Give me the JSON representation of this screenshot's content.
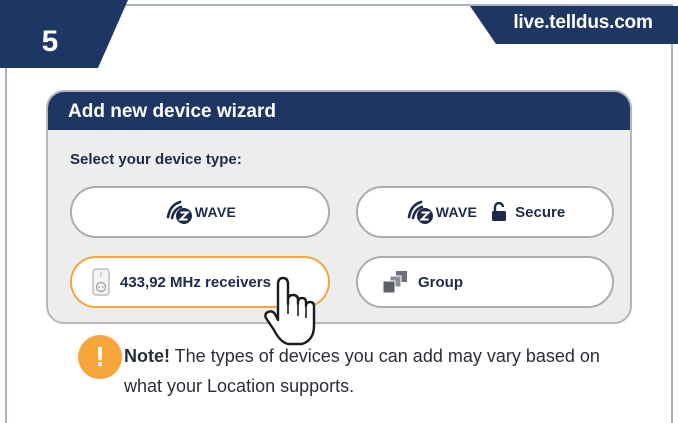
{
  "step": {
    "number": "5"
  },
  "host": {
    "label": "live.telldus.com"
  },
  "wizard": {
    "title": "Add new device wizard",
    "subtitle": "Select your device type:",
    "options": [
      {
        "logo_text": "WAVE",
        "icon": "zwave-logo-icon"
      },
      {
        "logo_text": "WAVE",
        "icon": "zwave-logo-icon",
        "secure_label": "Secure",
        "secure_icon": "lock-open-icon"
      },
      {
        "label": "433,92 MHz receivers",
        "icon": "plug-receiver-icon",
        "highlighted": true
      },
      {
        "label": "Group",
        "icon": "group-stack-icon"
      }
    ]
  },
  "note": {
    "bold": "Note!",
    "text": " The types of devices you can add may vary based on what your Location supports.",
    "icon": "exclamation-icon"
  },
  "colors": {
    "navy": "#1d3663",
    "orange": "#f6a53b",
    "panel_bg": "#ededee"
  },
  "cursor_icon": "hand-pointer-icon"
}
